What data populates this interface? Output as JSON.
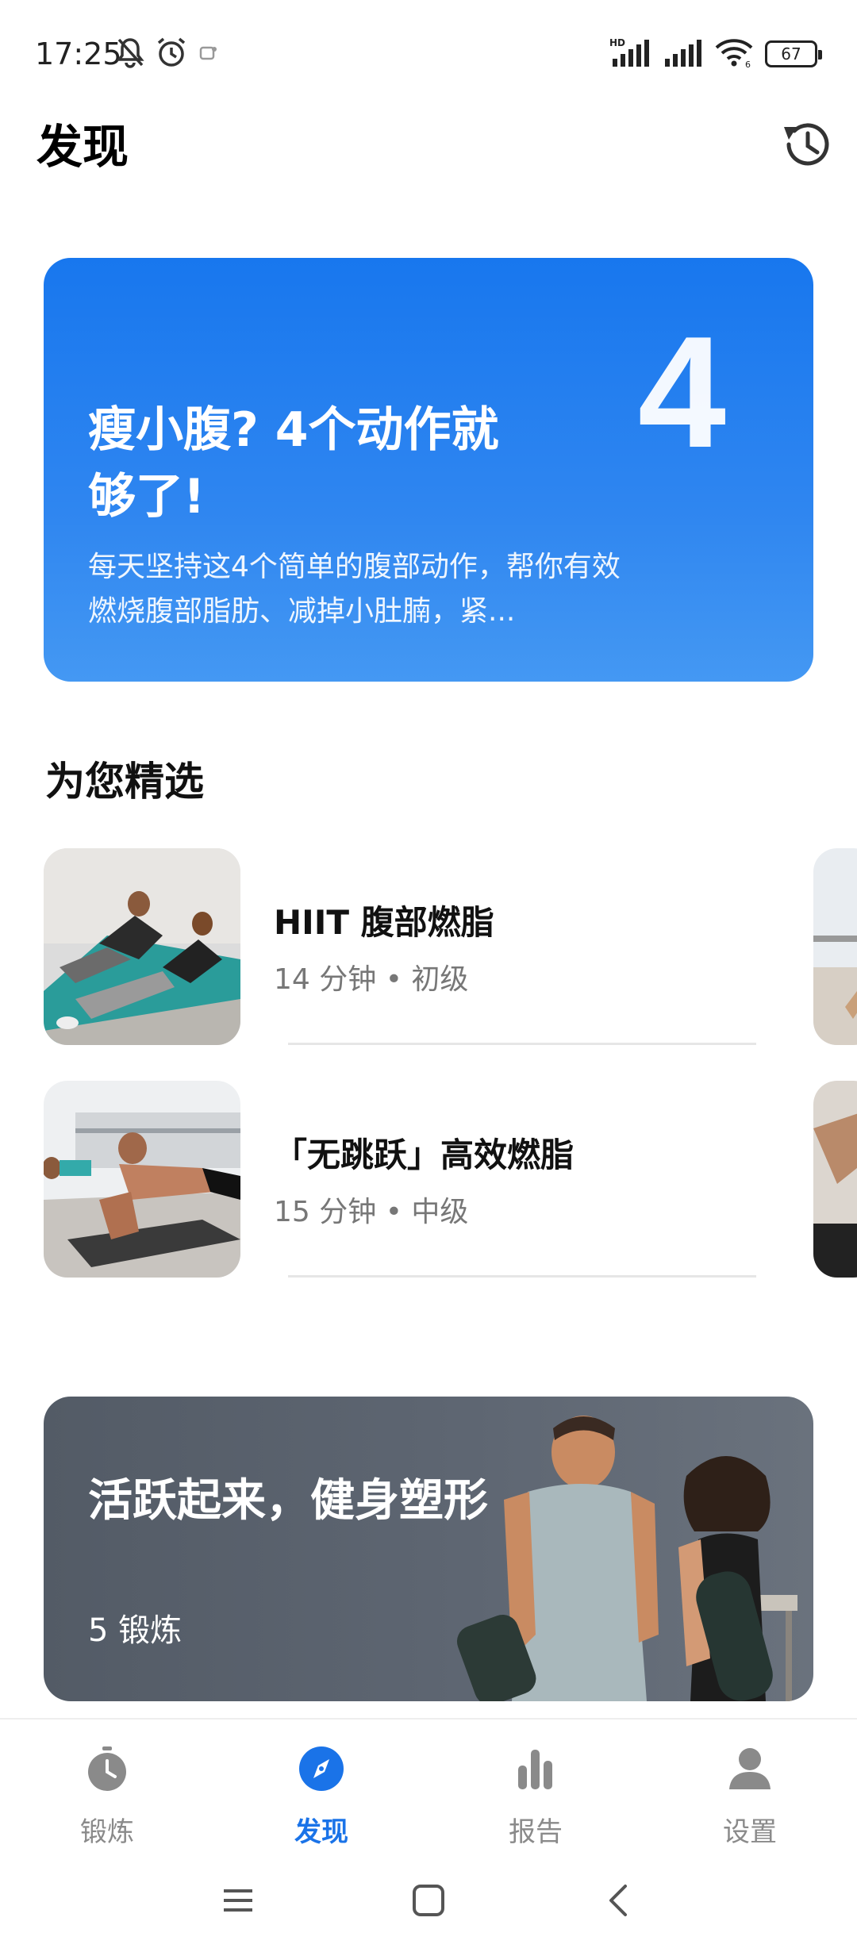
{
  "status_bar": {
    "time": "17:25",
    "battery": "67",
    "icons": [
      "bell-off-icon",
      "alarm-icon",
      "notification-icon",
      "hd-signal-icon",
      "signal-icon",
      "wifi-icon",
      "battery-icon"
    ]
  },
  "header": {
    "title": "发现",
    "history_icon": "history-icon"
  },
  "hero": {
    "number": "4",
    "title": "瘦小腹? 4个动作就够了!",
    "description": "每天坚持这4个简单的腹部动作，帮你有效燃烧腹部脂肪、减掉小肚腩，紧..."
  },
  "section": {
    "title": "为您精选"
  },
  "items": [
    {
      "title": "HIIT 腹部燃脂",
      "meta": "14 分钟 • 初级"
    },
    {
      "title": "「无跳跃」高效燃脂",
      "meta": "15 分钟 • 中级"
    }
  ],
  "promo": {
    "title": "活跃起来，健身塑形",
    "count": "5 锻炼"
  },
  "bottom_nav": {
    "items": [
      {
        "label": "锻炼",
        "icon": "stopwatch-icon",
        "active": false
      },
      {
        "label": "发现",
        "icon": "compass-icon",
        "active": true
      },
      {
        "label": "报告",
        "icon": "bar-chart-icon",
        "active": false
      },
      {
        "label": "设置",
        "icon": "person-icon",
        "active": false
      }
    ]
  },
  "colors": {
    "accent": "#1a73e8",
    "hero_blue": "#1877ee",
    "inactive": "#8a8a8a"
  }
}
